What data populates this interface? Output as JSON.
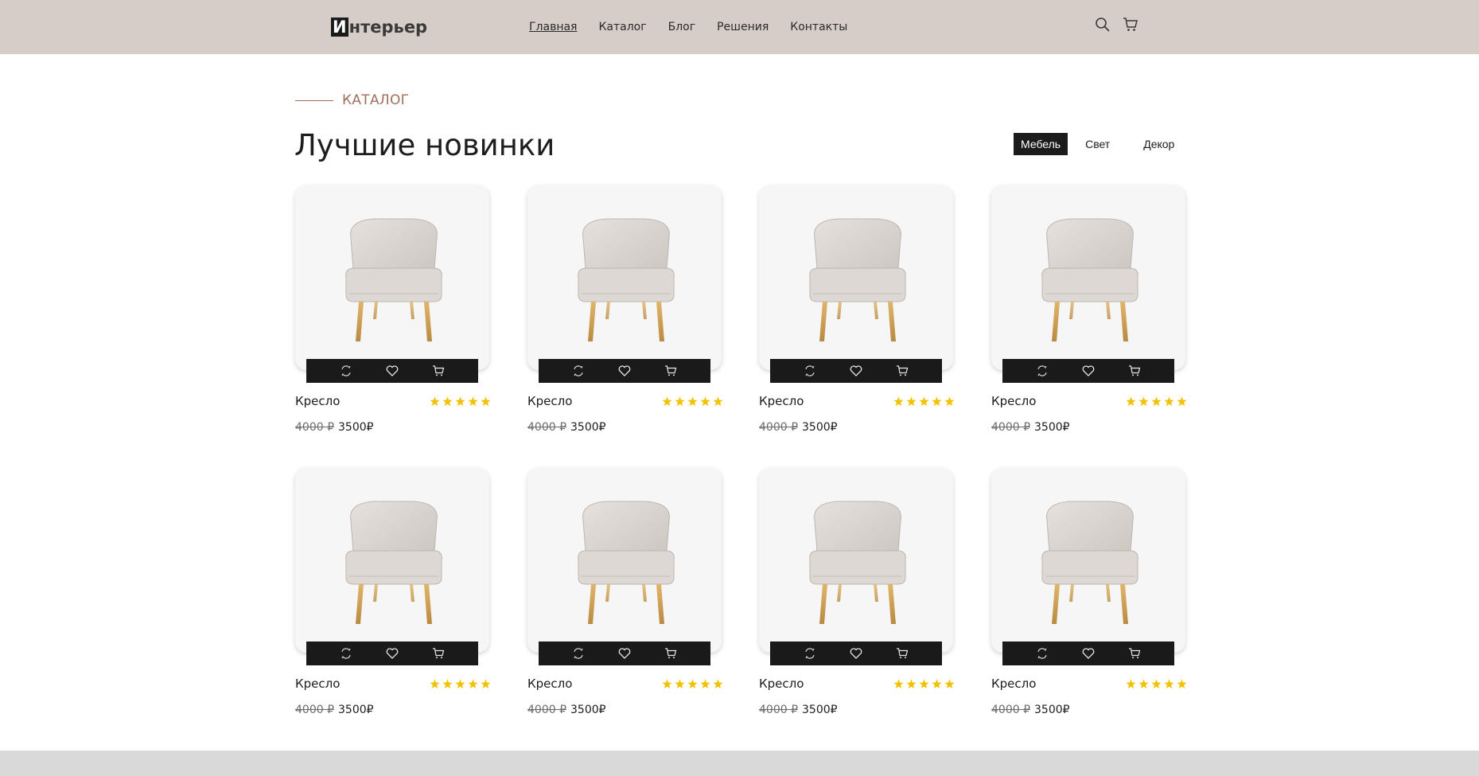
{
  "header": {
    "logo": {
      "mark": "И",
      "rest": "нтерьер"
    },
    "nav": [
      {
        "label": "Главная",
        "active": true
      },
      {
        "label": "Каталог",
        "active": false
      },
      {
        "label": "Блог",
        "active": false
      },
      {
        "label": "Решения",
        "active": false
      },
      {
        "label": "Контакты",
        "active": false
      }
    ],
    "icons": [
      "search-icon",
      "cart-icon"
    ]
  },
  "section": {
    "label": "КАТАЛОГ",
    "title": "Лучшие новинки"
  },
  "filters": [
    {
      "label": "Мебель",
      "active": true
    },
    {
      "label": "Свет",
      "active": false
    },
    {
      "label": "Декор",
      "active": false
    }
  ],
  "products": [
    {
      "name": "Кресло",
      "old_price": "4000 ₽",
      "price": "3500₽",
      "rating": 5
    },
    {
      "name": "Кресло",
      "old_price": "4000 ₽",
      "price": "3500₽",
      "rating": 5
    },
    {
      "name": "Кресло",
      "old_price": "4000 ₽",
      "price": "3500₽",
      "rating": 5
    },
    {
      "name": "Кресло",
      "old_price": "4000 ₽",
      "price": "3500₽",
      "rating": 5
    },
    {
      "name": "Кресло",
      "old_price": "4000 ₽",
      "price": "3500₽",
      "rating": 5
    },
    {
      "name": "Кресло",
      "old_price": "4000 ₽",
      "price": "3500₽",
      "rating": 5
    },
    {
      "name": "Кресло",
      "old_price": "4000 ₽",
      "price": "3500₽",
      "rating": 5
    },
    {
      "name": "Кресло",
      "old_price": "4000 ₽",
      "price": "3500₽",
      "rating": 5
    }
  ],
  "card_actions": [
    "compare-icon",
    "heart-icon",
    "cart-icon"
  ],
  "colors": {
    "header_bg": "#d6cdc8",
    "accent": "#a0705a",
    "dark": "#1a1a1a",
    "star": "#f2c200",
    "footer": "#d9d9d9"
  }
}
